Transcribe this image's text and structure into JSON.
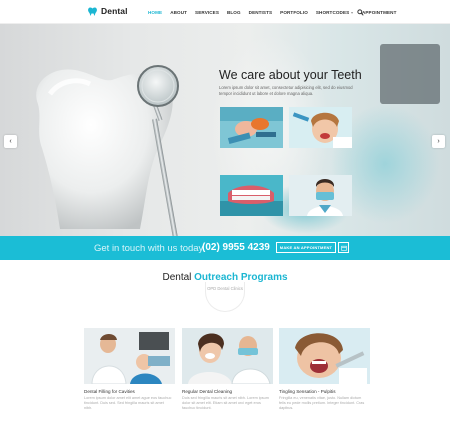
{
  "brand": {
    "name": "Dental",
    "accent": "#1bb6d2"
  },
  "nav": {
    "items": [
      {
        "label": "HOME",
        "active": true
      },
      {
        "label": "ABOUT"
      },
      {
        "label": "SERVICES"
      },
      {
        "label": "BLOG"
      },
      {
        "label": "DENTISTS"
      },
      {
        "label": "PORTFOLIO"
      },
      {
        "label": "SHORTCODES",
        "has_dropdown": true
      },
      {
        "label": "APPOINTMENT"
      }
    ],
    "search_icon": "search-icon"
  },
  "hero": {
    "title": "We care about your Teeth",
    "description": "Lorem ipsum dolor sit amet, consectetur adipisicing elit, sed do eiusmod tempor incididunt ut labore et dolore magna aliqua.",
    "prev_icon": "chevron-left-icon",
    "next_icon": "chevron-right-icon"
  },
  "cta": {
    "text": "Get in touch with us today",
    "phone": "(02) 9955 4239",
    "button_label": "MAKE AN APPOINTMENT",
    "icon": "calendar-icon"
  },
  "outreach": {
    "title_plain": "Dental",
    "title_highlight": "Outreach Programs",
    "subtitle": "OPD Dental Clinics",
    "cards": [
      {
        "title": "Dental Filling for Cavities",
        "desc": "Lorem ipsum dolor amet elit amet ague eos fauchuc tincidunt. Duis sed. Sed fringilla mauris sit amet nibh."
      },
      {
        "title": "Regular Dental Cleaning",
        "desc": "Duis sed fringilla mauris sit amet nibh. Lorem ipsum dolor sit amet elit. Etiam sit amet orci eget eros fauchuc tincidunt."
      },
      {
        "title": "Tingling Sensation - Pulpitis",
        "desc": "Fringilla eu, venenatis vitae, justo. Nullam dictum felis eu pede mollis pretium. Integer tincidunt. Cras dapibus."
      }
    ]
  }
}
